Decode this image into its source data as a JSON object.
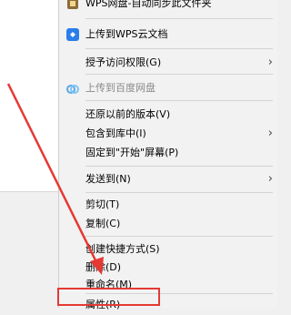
{
  "menu": {
    "items": [
      {
        "label": "WPS网盘-自动同步此文件夹",
        "icon": "wps-sync-icon"
      },
      {
        "label": "上传到WPS云文档",
        "icon": "wps-cloud-icon"
      },
      {
        "label": "授予访问权限(G)",
        "submenu": true
      },
      {
        "label": "上传到百度网盘",
        "icon": "baidu-netdisk-icon",
        "disabled": true
      },
      {
        "label": "还原以前的版本(V)"
      },
      {
        "label": "包含到库中(I)",
        "submenu": true
      },
      {
        "label": "固定到\"开始\"屏幕(P)"
      },
      {
        "label": "发送到(N)",
        "submenu": true
      },
      {
        "label": "剪切(T)"
      },
      {
        "label": "复制(C)"
      },
      {
        "label": "创建快捷方式(S)"
      },
      {
        "label": "删除(D)"
      },
      {
        "label": "重命名(M)"
      },
      {
        "label": "属性(R)"
      }
    ],
    "submenu_glyph": "›"
  },
  "highlight_color": "#e53935",
  "arrow_color": "#e53935"
}
